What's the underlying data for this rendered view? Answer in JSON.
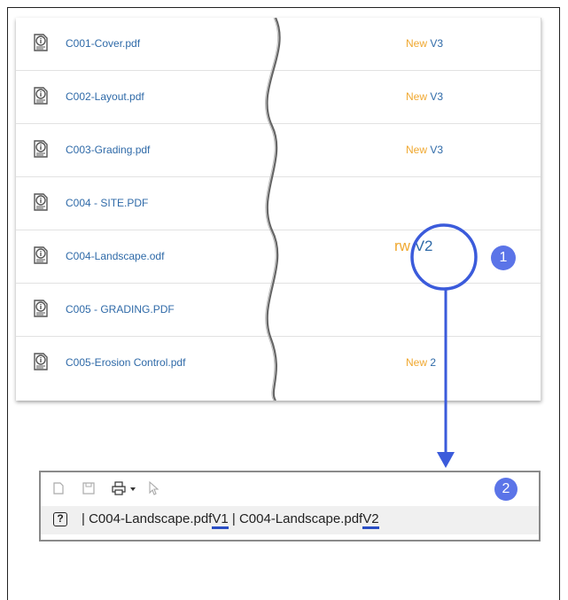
{
  "files": [
    {
      "name": "C001-Cover.pdf",
      "new": "New",
      "version": "V3"
    },
    {
      "name": "C002-Layout.pdf",
      "new": "New",
      "version": "V3"
    },
    {
      "name": "C003-Grading.pdf",
      "new": "New",
      "version": "V3"
    },
    {
      "name": "C004 - SITE.PDF",
      "new": "",
      "version": ""
    },
    {
      "name": "C004-Landscape.odf",
      "new": "rw",
      "version": "V2"
    },
    {
      "name": "C005 - GRADING.PDF",
      "new": "",
      "version": ""
    },
    {
      "name": "C005-Erosion Control.pdf",
      "new": "New",
      "version": "2"
    }
  ],
  "callouts": {
    "first": "1",
    "second": "2"
  },
  "viewer": {
    "help": "?",
    "separator": "|",
    "file_a": "C004-Landscape.pdf",
    "version_a": "V1",
    "mid_sep": " | ",
    "file_b": "C004-Landscape.pdf",
    "version_b": "V2"
  },
  "colors": {
    "accent": "#3b5bdb",
    "new": "#f0a830",
    "link": "#2f6aa8"
  }
}
